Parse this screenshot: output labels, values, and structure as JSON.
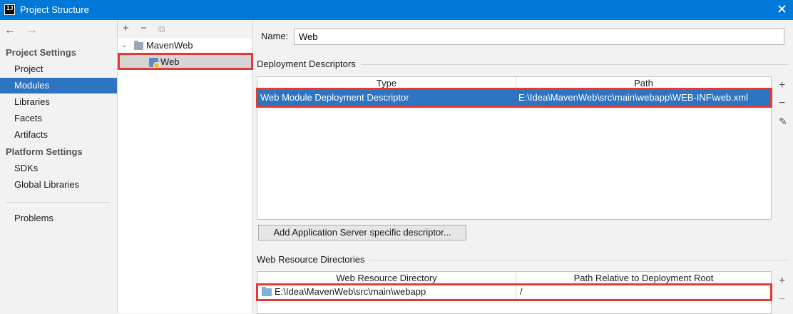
{
  "window": {
    "title": "Project Structure",
    "app_logo": "IJ",
    "close_glyph": "✕"
  },
  "nav": {
    "back_glyph": "←",
    "forward_glyph": "→",
    "project_settings": "Project Settings",
    "platform_settings": "Platform Settings",
    "items": {
      "project": "Project",
      "modules": "Modules",
      "libraries": "Libraries",
      "facets": "Facets",
      "artifacts": "Artifacts",
      "sdks": "SDKs",
      "global_libraries": "Global Libraries",
      "problems": "Problems"
    }
  },
  "tree": {
    "toolbar": {
      "add": "+",
      "remove": "−",
      "copy": "⧉"
    },
    "root": "MavenWeb",
    "child": "Web",
    "chevron": "⌄"
  },
  "content": {
    "name_label": "Name:",
    "name_value": "Web",
    "deployment_title": "Deployment Descriptors",
    "deployment_columns": {
      "type": "Type",
      "path": "Path"
    },
    "deployment_rows": [
      {
        "type": "Web Module Deployment Descriptor",
        "path": "E:\\Idea\\MavenWeb\\src\\main\\webapp\\WEB-INF\\web.xml"
      }
    ],
    "add_descriptor_button": "Add Application Server specific descriptor...",
    "resource_title": "Web Resource Directories",
    "resource_columns": {
      "dir": "Web Resource Directory",
      "rel": "Path Relative to Deployment Root"
    },
    "resource_rows": [
      {
        "dir": "E:\\Idea\\MavenWeb\\src\\main\\webapp",
        "rel": "/"
      }
    ],
    "side_tools": {
      "add": "+",
      "remove": "−",
      "edit": "✎"
    }
  },
  "colors": {
    "titlebar": "#0078d7",
    "selection": "#2e74c0",
    "highlight": "#e53935"
  }
}
